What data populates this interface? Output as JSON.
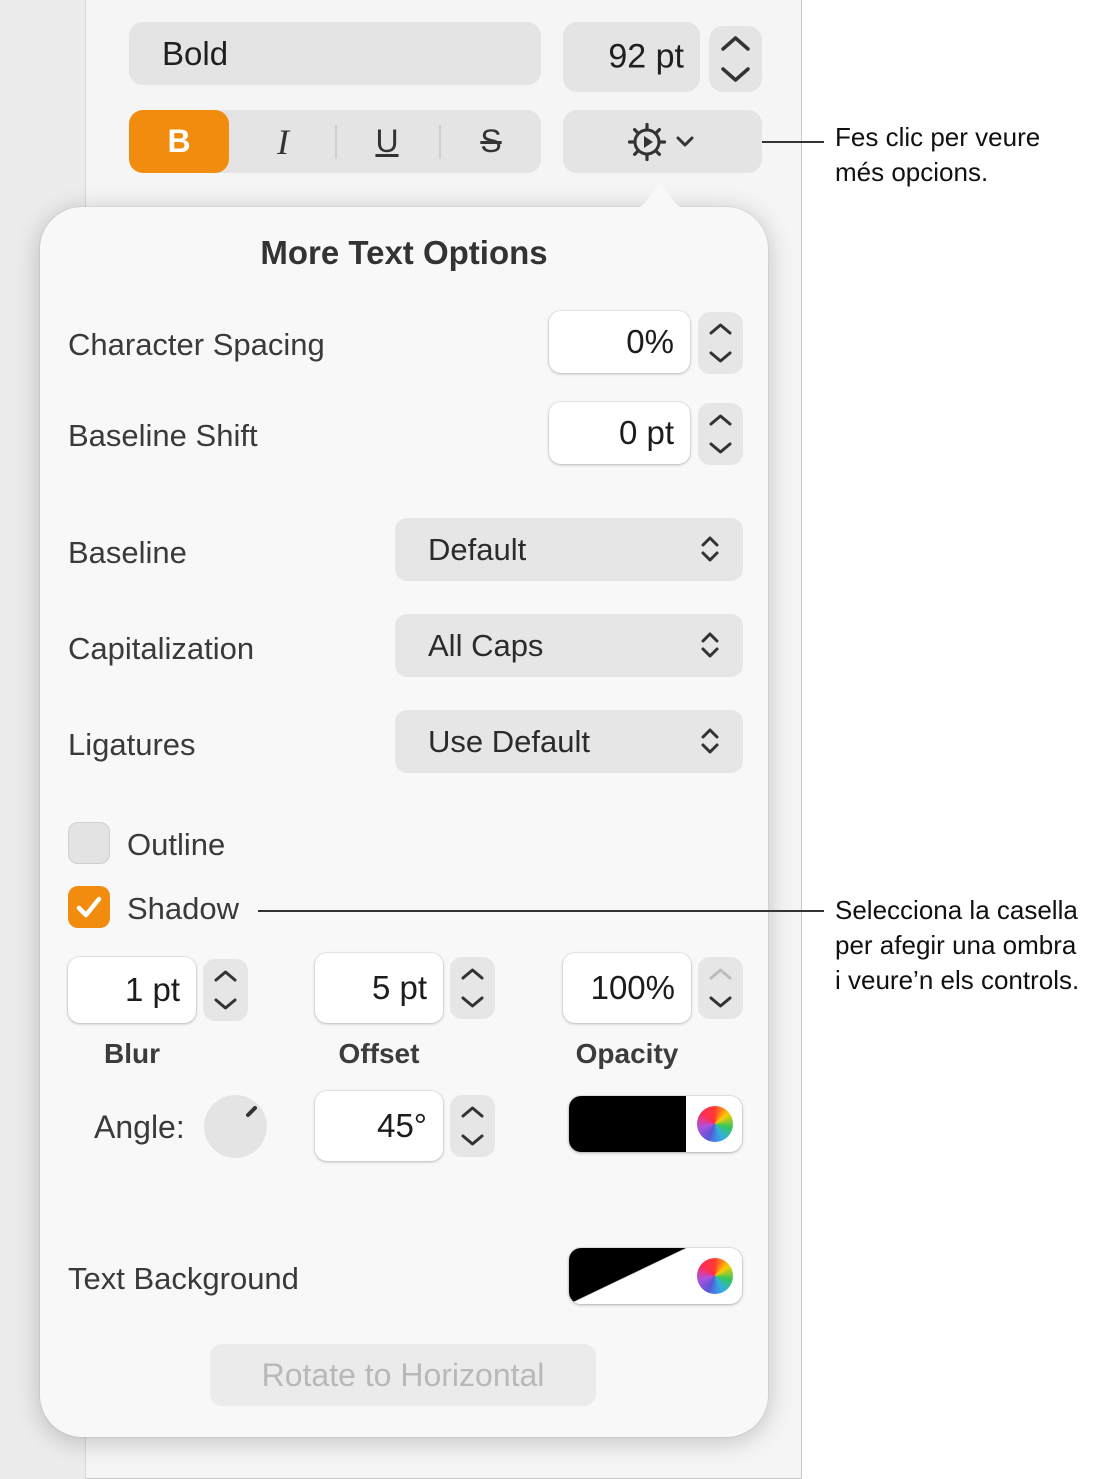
{
  "toolbar": {
    "font_style": "Bold",
    "font_size": "92 pt",
    "style_buttons": {
      "bold": "B",
      "italic": "I",
      "underline": "U",
      "strikethrough": "S"
    }
  },
  "popover": {
    "title": "More Text Options",
    "character_spacing": {
      "label": "Character Spacing",
      "value": "0%"
    },
    "baseline_shift": {
      "label": "Baseline Shift",
      "value": "0 pt"
    },
    "baseline": {
      "label": "Baseline",
      "value": "Default"
    },
    "capitalization": {
      "label": "Capitalization",
      "value": "All Caps"
    },
    "ligatures": {
      "label": "Ligatures",
      "value": "Use Default"
    },
    "outline": {
      "label": "Outline",
      "checked": false
    },
    "shadow": {
      "label": "Shadow",
      "checked": true,
      "blur": {
        "label": "Blur",
        "value": "1 pt"
      },
      "offset": {
        "label": "Offset",
        "value": "5 pt"
      },
      "opacity": {
        "label": "Opacity",
        "value": "100%"
      },
      "angle": {
        "label": "Angle:",
        "value": "45°"
      },
      "color": "#000000"
    },
    "text_background": {
      "label": "Text Background"
    },
    "rotate_button": "Rotate to Horizontal"
  },
  "callouts": {
    "more_options_line1": "Fes clic per veure",
    "more_options_line2": "més opcions.",
    "shadow_line1": "Selecciona la casella",
    "shadow_line2": "per afegir una ombra",
    "shadow_line3": "i veure’n els controls."
  },
  "colors": {
    "accent": "#f28c0f",
    "panel": "#f8f8f8",
    "control": "#e4e4e4"
  }
}
